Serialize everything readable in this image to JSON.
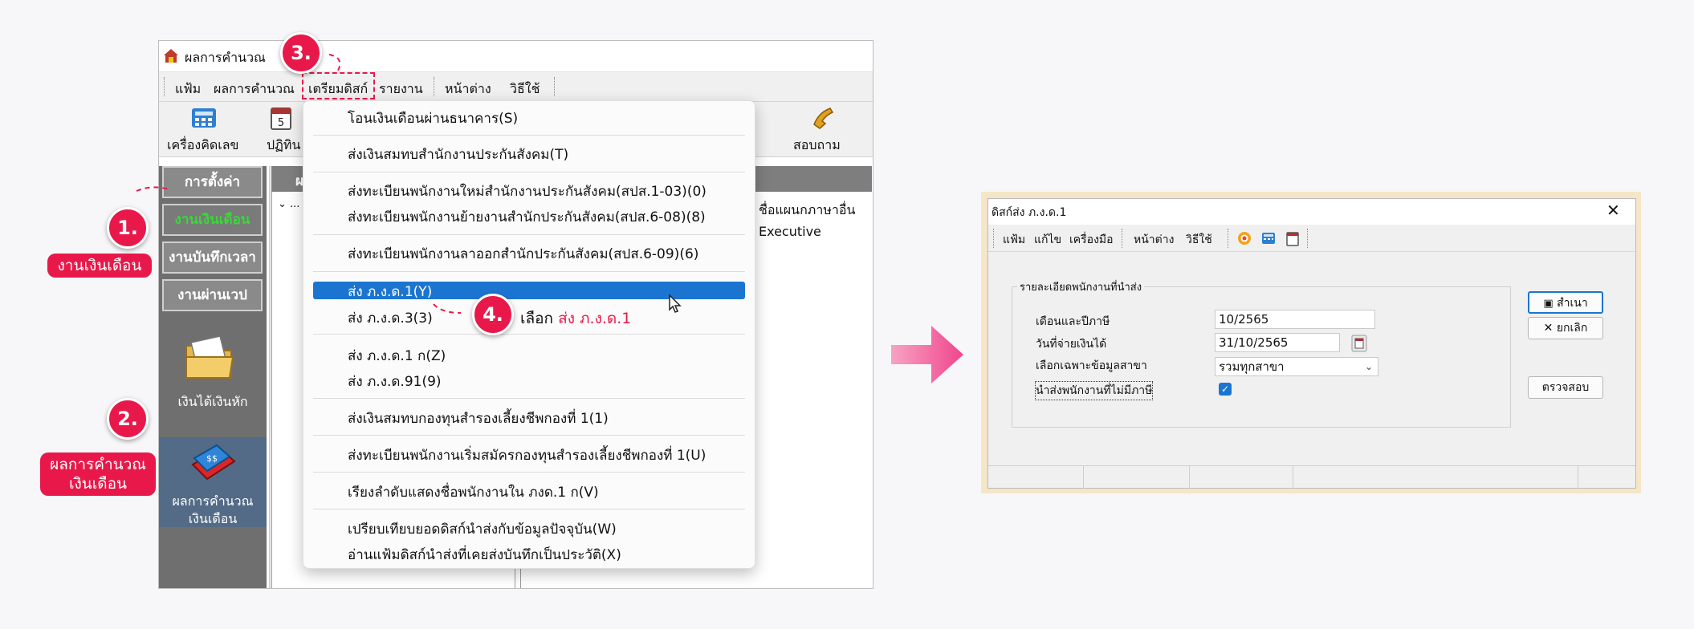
{
  "left_window": {
    "title": "ผลการคำนวณ",
    "menu": [
      "แฟ้ม",
      "ผลการคำนวณ",
      "เตรียมดิสก์",
      "รายงาน",
      "หน้าต่าง",
      "วิธีใช้"
    ],
    "toolbar": {
      "calculator": "เครื่องคิดเลข",
      "calendar": "ปฏิทิน",
      "help": "สอบถาม"
    },
    "sidebar": {
      "settings": "การตั้งค่า",
      "salary_work": "งานเงินเดือน",
      "time_record": "งานบันทึกเวลา",
      "shift_work": "งานผ่านเวป",
      "income_deduct": "เงินได้เงินหัก",
      "calc_result_line1": "ผลการคำนวณ",
      "calc_result_line2": "เงินเดือน"
    },
    "panel_head_short": "ผ",
    "tree_marker": "⌄ ...",
    "right_col": {
      "line1": "ชื่อแผนกภาษาอื่น",
      "line2": "Executive"
    },
    "dropdown": [
      "โอนเงินเดือนผ่านธนาคาร(S)",
      "ส่งเงินสมทบสำนักงานประกันสังคม(T)",
      "ส่งทะเบียนพนักงานใหม่สำนักงานประกันสังคม(สปส.1-03)(0)",
      "ส่งทะเบียนพนักงานย้ายงานสำนักประกันสังคม(สปส.6-08)(8)",
      "ส่งทะเบียนพนักงานลาออกสำนักประกันสังคม(สปส.6-09)(6)",
      "ส่ง ภ.ง.ด.1(Y)",
      "ส่ง ภ.ง.ด.3(3)",
      "ส่ง ภ.ง.ด.1 ก(Z)",
      "ส่ง ภ.ง.ด.91(9)",
      "ส่งเงินสมทบกองทุนสำรองเลี้ยงชีพกองที่ 1(1)",
      "ส่งทะเบียนพนักงานเริ่มสมัครกองทุนสำรองเลี้ยงชีพกองที่ 1(U)",
      "เรียงลำดับแสดงชื่อพนักงานใน  ภงด.1 ก(V)",
      "เปรียบเทียบยอดดิสก์นำส่งกับข้อมูลปัจจุบัน(W)",
      "อ่านแฟ้มดิสก์นำส่งที่เคยส่งบันทึกเป็นประวัติ(X)"
    ]
  },
  "annotations": {
    "step1": "1.",
    "step1_label": "งานเงินเดือน",
    "step2": "2.",
    "step2_label_line1": "ผลการคำนวณ",
    "step2_label_line2": "เงินเดือน",
    "step3": "3.",
    "step4": "4.",
    "step4_prefix": "เลือก",
    "step4_highlight": "ส่ง ภ.ง.ด.1"
  },
  "right_window": {
    "title": "ดิสก์ส่ง ภ.ง.ด.1",
    "close": "✕",
    "menu": [
      "แฟ้ม",
      "แก้ไข",
      "เครื่องมือ",
      "หน้าต่าง",
      "วิธีใช้"
    ],
    "group_title": "รายละเอียดพนักงานที่นำส่ง",
    "labels": {
      "month_year": "เดือนและปีภาษี",
      "pay_date": "วันที่จ่ายเงินได้",
      "branch": "เลือกเฉพาะข้อมูลสาขา",
      "no_tax": "นำส่งพนักงานที่ไม่มีภาษี"
    },
    "values": {
      "month_year": "10/2565",
      "pay_date": "31/10/2565",
      "branch": "รวมทุกสาขา"
    },
    "no_tax_checked": true,
    "buttons": {
      "copy": "สำเนา",
      "cancel": "ยกเลิก",
      "check": "ตรวจสอบ"
    }
  },
  "colors": {
    "accent": "#e8194a",
    "highlight": "#1b75d0",
    "arrow": "#f0458c",
    "active_text": "#39d839"
  }
}
